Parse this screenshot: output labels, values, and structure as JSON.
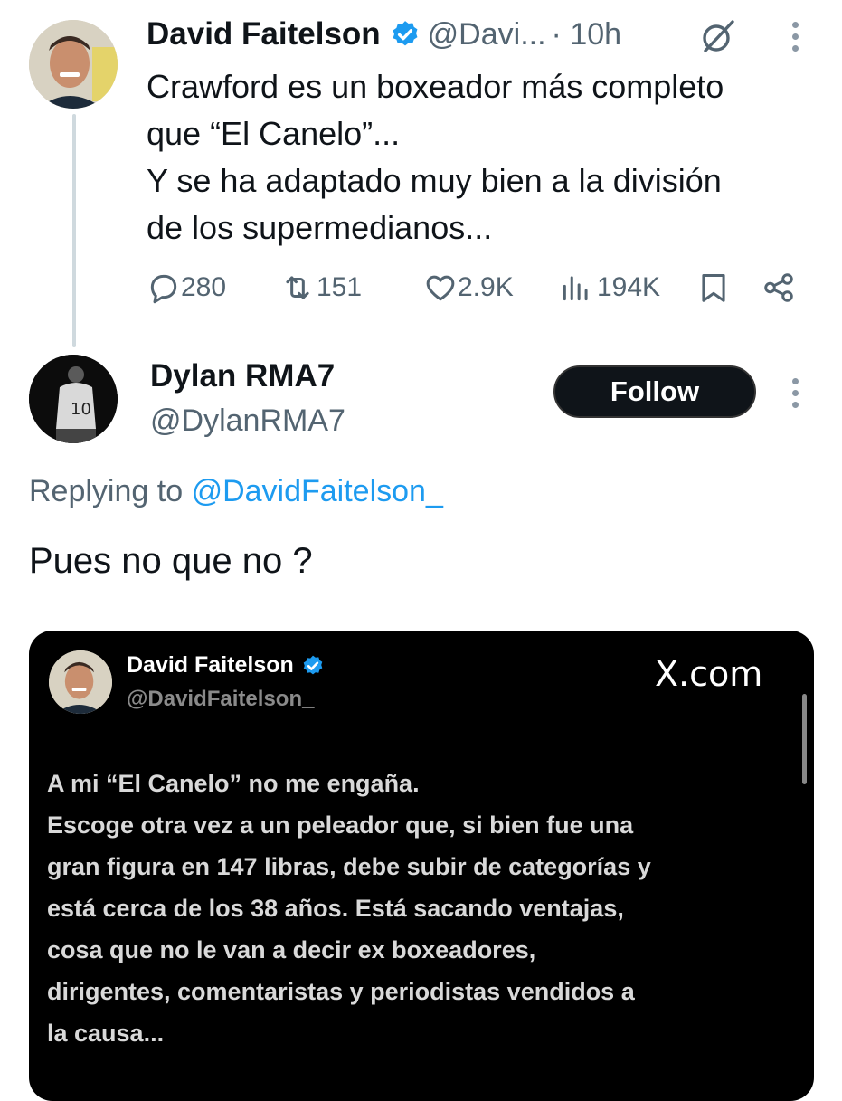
{
  "original_tweet": {
    "author_name": "David Faitelson",
    "handle": "@Davi...",
    "time": "· 10h",
    "text": "Crawford es un boxeador más completo\nque “El Canelo”...\nY se ha adaptado muy bien a la división\nde los supermedianos...",
    "stats": {
      "replies": "280",
      "reposts": "151",
      "likes": "2.9K",
      "views": "194K"
    }
  },
  "reply": {
    "author_name": "Dylan RMA7",
    "handle": "@DylanRMA7",
    "follow_label": "Follow",
    "replying_prefix": "Replying to",
    "replying_to": "@DavidFaitelson_",
    "text": "Pues no que no ?"
  },
  "embedded_image": {
    "author_name": "David Faitelson",
    "handle": "@DavidFaitelson_",
    "site": "X.com",
    "text": "A mi “El Canelo” no me engaña.\nEscoge otra vez a un peleador que, si bien fue una\ngran figura en 147 libras, debe subir de categorías y\nestá cerca de los 38 años. Está sacando ventajas,\ncosa que no le van a decir ex boxeadores,\ndirigentes, comentaristas y periodistas vendidos a\nla causa..."
  },
  "colors": {
    "accent": "#1d9bf0",
    "text_primary": "#0f1419",
    "text_secondary": "#536471",
    "follow_button_bg": "#0f1419"
  },
  "icons": [
    "verified-badge-icon",
    "grok-icon",
    "more-icon",
    "reply-icon",
    "repost-icon",
    "like-icon",
    "views-icon",
    "bookmark-icon",
    "share-icon"
  ]
}
